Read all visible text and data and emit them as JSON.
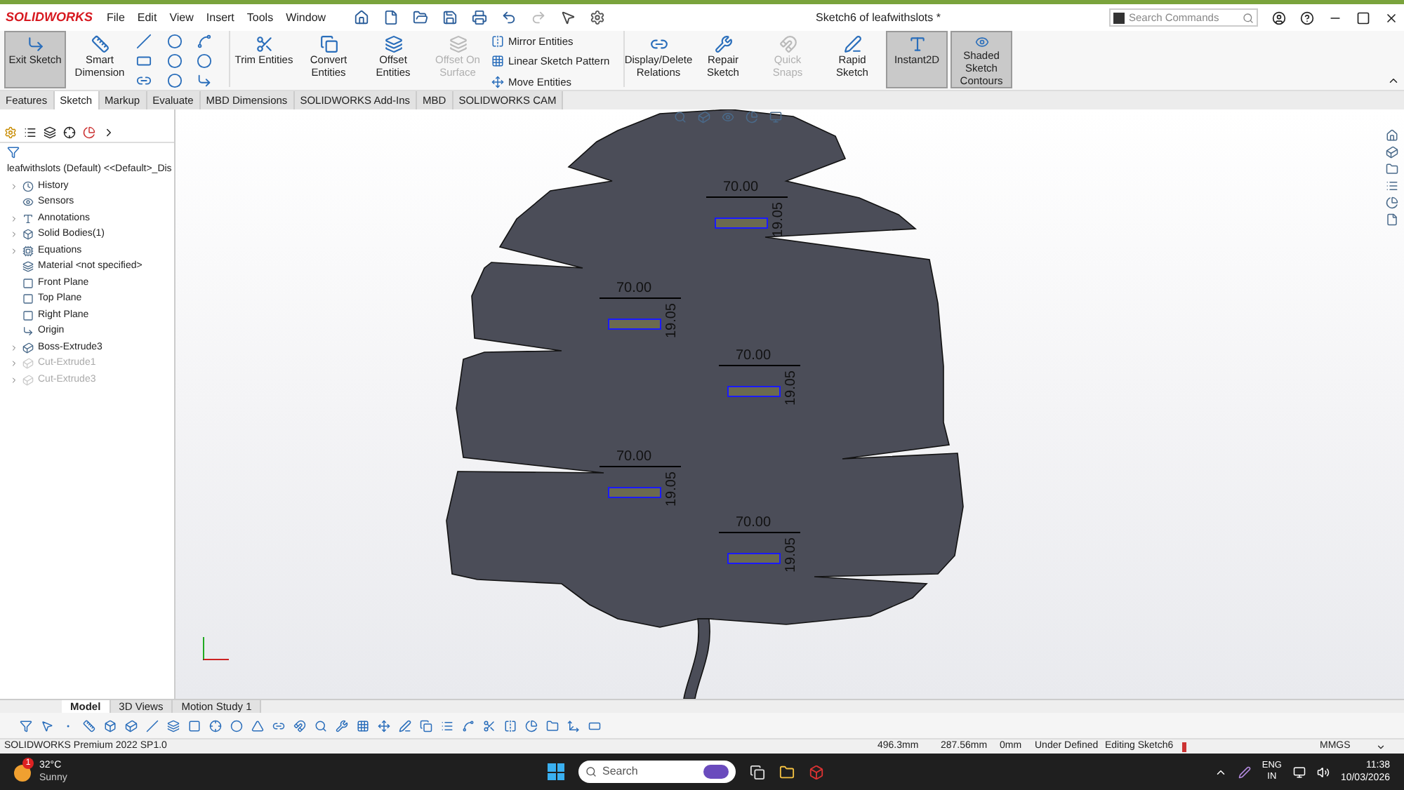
{
  "app": {
    "logo": "SOLIDWORKS",
    "menus": [
      "File",
      "Edit",
      "View",
      "Insert",
      "Tools",
      "Window"
    ],
    "document_title": "Sketch6 of leafwithslots *",
    "search": {
      "placeholder": "Search Commands"
    }
  },
  "ribbon": {
    "main_commands": [
      {
        "label": "Exit Sketch",
        "selected": true,
        "disabled": false
      },
      {
        "label": "Smart Dimension",
        "selected": false,
        "disabled": false
      }
    ],
    "edit_commands": [
      {
        "label": "Trim Entities",
        "selected": false,
        "disabled": false
      },
      {
        "label": "Convert Entities",
        "selected": false,
        "disabled": false
      },
      {
        "label": "Offset Entities",
        "selected": false,
        "disabled": false
      },
      {
        "label": "Offset On Surface",
        "selected": false,
        "disabled": true
      }
    ],
    "list_commands": [
      "Mirror Entities",
      "Linear Sketch Pattern",
      "Move Entities"
    ],
    "other_commands": [
      {
        "label": "Display/Delete Relations",
        "selected": false,
        "disabled": false
      },
      {
        "label": "Repair Sketch",
        "selected": false,
        "disabled": false
      },
      {
        "label": "Quick Snaps",
        "selected": false,
        "disabled": true
      },
      {
        "label": "Rapid Sketch",
        "selected": false,
        "disabled": false
      },
      {
        "label": "Instant2D",
        "selected": true,
        "disabled": false
      },
      {
        "label": "Shaded Sketch Contours",
        "selected": true,
        "disabled": false
      }
    ]
  },
  "command_tabs": [
    {
      "label": "Features",
      "selected": false
    },
    {
      "label": "Sketch",
      "selected": true
    },
    {
      "label": "Markup",
      "selected": false
    },
    {
      "label": "Evaluate",
      "selected": false
    },
    {
      "label": "MBD Dimensions",
      "selected": false
    },
    {
      "label": "SOLIDWORKS Add-Ins",
      "selected": false
    },
    {
      "label": "MBD",
      "selected": false
    },
    {
      "label": "SOLIDWORKS CAM",
      "selected": false
    }
  ],
  "feature_tree": {
    "root": "leafwithslots (Default) <<Default>_Dis",
    "items": [
      {
        "label": "History",
        "expandable": true,
        "suppressed": false
      },
      {
        "label": "Sensors",
        "expandable": false,
        "suppressed": false
      },
      {
        "label": "Annotations",
        "expandable": true,
        "suppressed": false
      },
      {
        "label": "Solid Bodies(1)",
        "expandable": true,
        "suppressed": false
      },
      {
        "label": "Equations",
        "expandable": true,
        "suppressed": false
      },
      {
        "label": "Material <not specified>",
        "expandable": false,
        "suppressed": false
      },
      {
        "label": "Front Plane",
        "expandable": false,
        "suppressed": false
      },
      {
        "label": "Top Plane",
        "expandable": false,
        "suppressed": false
      },
      {
        "label": "Right Plane",
        "expandable": false,
        "suppressed": false
      },
      {
        "label": "Origin",
        "expandable": false,
        "suppressed": false
      },
      {
        "label": "Boss-Extrude3",
        "expandable": true,
        "suppressed": false
      },
      {
        "label": "Cut-Extrude1",
        "expandable": true,
        "suppressed": true
      },
      {
        "label": "Cut-Extrude3",
        "expandable": true,
        "suppressed": true
      }
    ]
  },
  "slots": [
    {
      "width_label": "70.00",
      "height_label": "19.05"
    },
    {
      "width_label": "70.00",
      "height_label": "19.05"
    },
    {
      "width_label": "70.00",
      "height_label": "19.05"
    },
    {
      "width_label": "70.00",
      "height_label": "19.05"
    },
    {
      "width_label": "70.00",
      "height_label": "19.05"
    }
  ],
  "bottom_tabs": [
    {
      "label": "Model",
      "selected": true
    },
    {
      "label": "3D Views",
      "selected": false
    },
    {
      "label": "Motion Study 1",
      "selected": false
    }
  ],
  "status_bar": {
    "product": "SOLIDWORKS Premium 2022 SP1.0",
    "x": "496.3mm",
    "y": "287.56mm",
    "z": "0mm",
    "status": "Under Defined",
    "mode": "Editing Sketch6",
    "units": "MMGS"
  },
  "taskbar": {
    "weather": {
      "badge": "1",
      "temperature": "32°C",
      "condition": "Sunny"
    },
    "search": {
      "placeholder": "Search"
    },
    "language": "ENG",
    "region": "IN",
    "time": "11:38",
    "date": "10/03/2026"
  }
}
